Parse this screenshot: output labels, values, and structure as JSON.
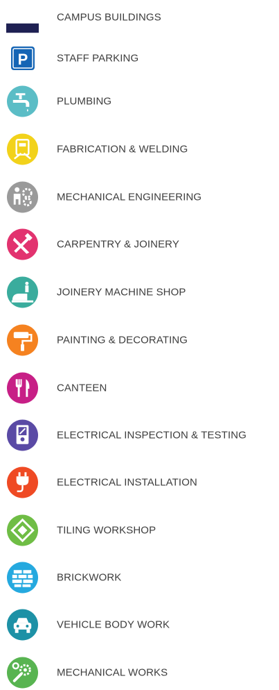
{
  "legend": {
    "items": [
      {
        "label": "CAMPUS BUILDINGS",
        "icon": "building-swatch-icon",
        "color": "#1f2153"
      },
      {
        "label": "STAFF PARKING",
        "icon": "parking-icon",
        "color": "#1565b5"
      },
      {
        "label": "PLUMBING",
        "icon": "tap-icon",
        "color": "#5bbdc6"
      },
      {
        "label": "FABRICATION & WELDING",
        "icon": "welding-icon",
        "color": "#f2d21b"
      },
      {
        "label": "MECHANICAL ENGINEERING",
        "icon": "gears-person-icon",
        "color": "#9a9a9a"
      },
      {
        "label": "CARPENTRY & JOINERY",
        "icon": "hammer-saw-icon",
        "color": "#e2336f"
      },
      {
        "label": "JOINERY MACHINE SHOP",
        "icon": "machine-saw-icon",
        "color": "#3aac9d"
      },
      {
        "label": "PAINTING & DECORATING",
        "icon": "paint-roller-icon",
        "color": "#f58220"
      },
      {
        "label": "CANTEEN",
        "icon": "fork-knife-icon",
        "color": "#c71f86"
      },
      {
        "label": "ELECTRICAL INSPECTION & TESTING",
        "icon": "multimeter-icon",
        "color": "#5a4aa5"
      },
      {
        "label": "ELECTRICAL INSTALLATION",
        "icon": "plug-icon",
        "color": "#ef4a24"
      },
      {
        "label": "TILING WORKSHOP",
        "icon": "tiles-icon",
        "color": "#6fbd45"
      },
      {
        "label": "BRICKWORK",
        "icon": "brick-wall-icon",
        "color": "#25a9df"
      },
      {
        "label": "VEHICLE BODY WORK",
        "icon": "car-icon",
        "color": "#1d91a6"
      },
      {
        "label": "MECHANICAL WORKS",
        "icon": "wrench-gear-icon",
        "color": "#58b451"
      }
    ]
  }
}
